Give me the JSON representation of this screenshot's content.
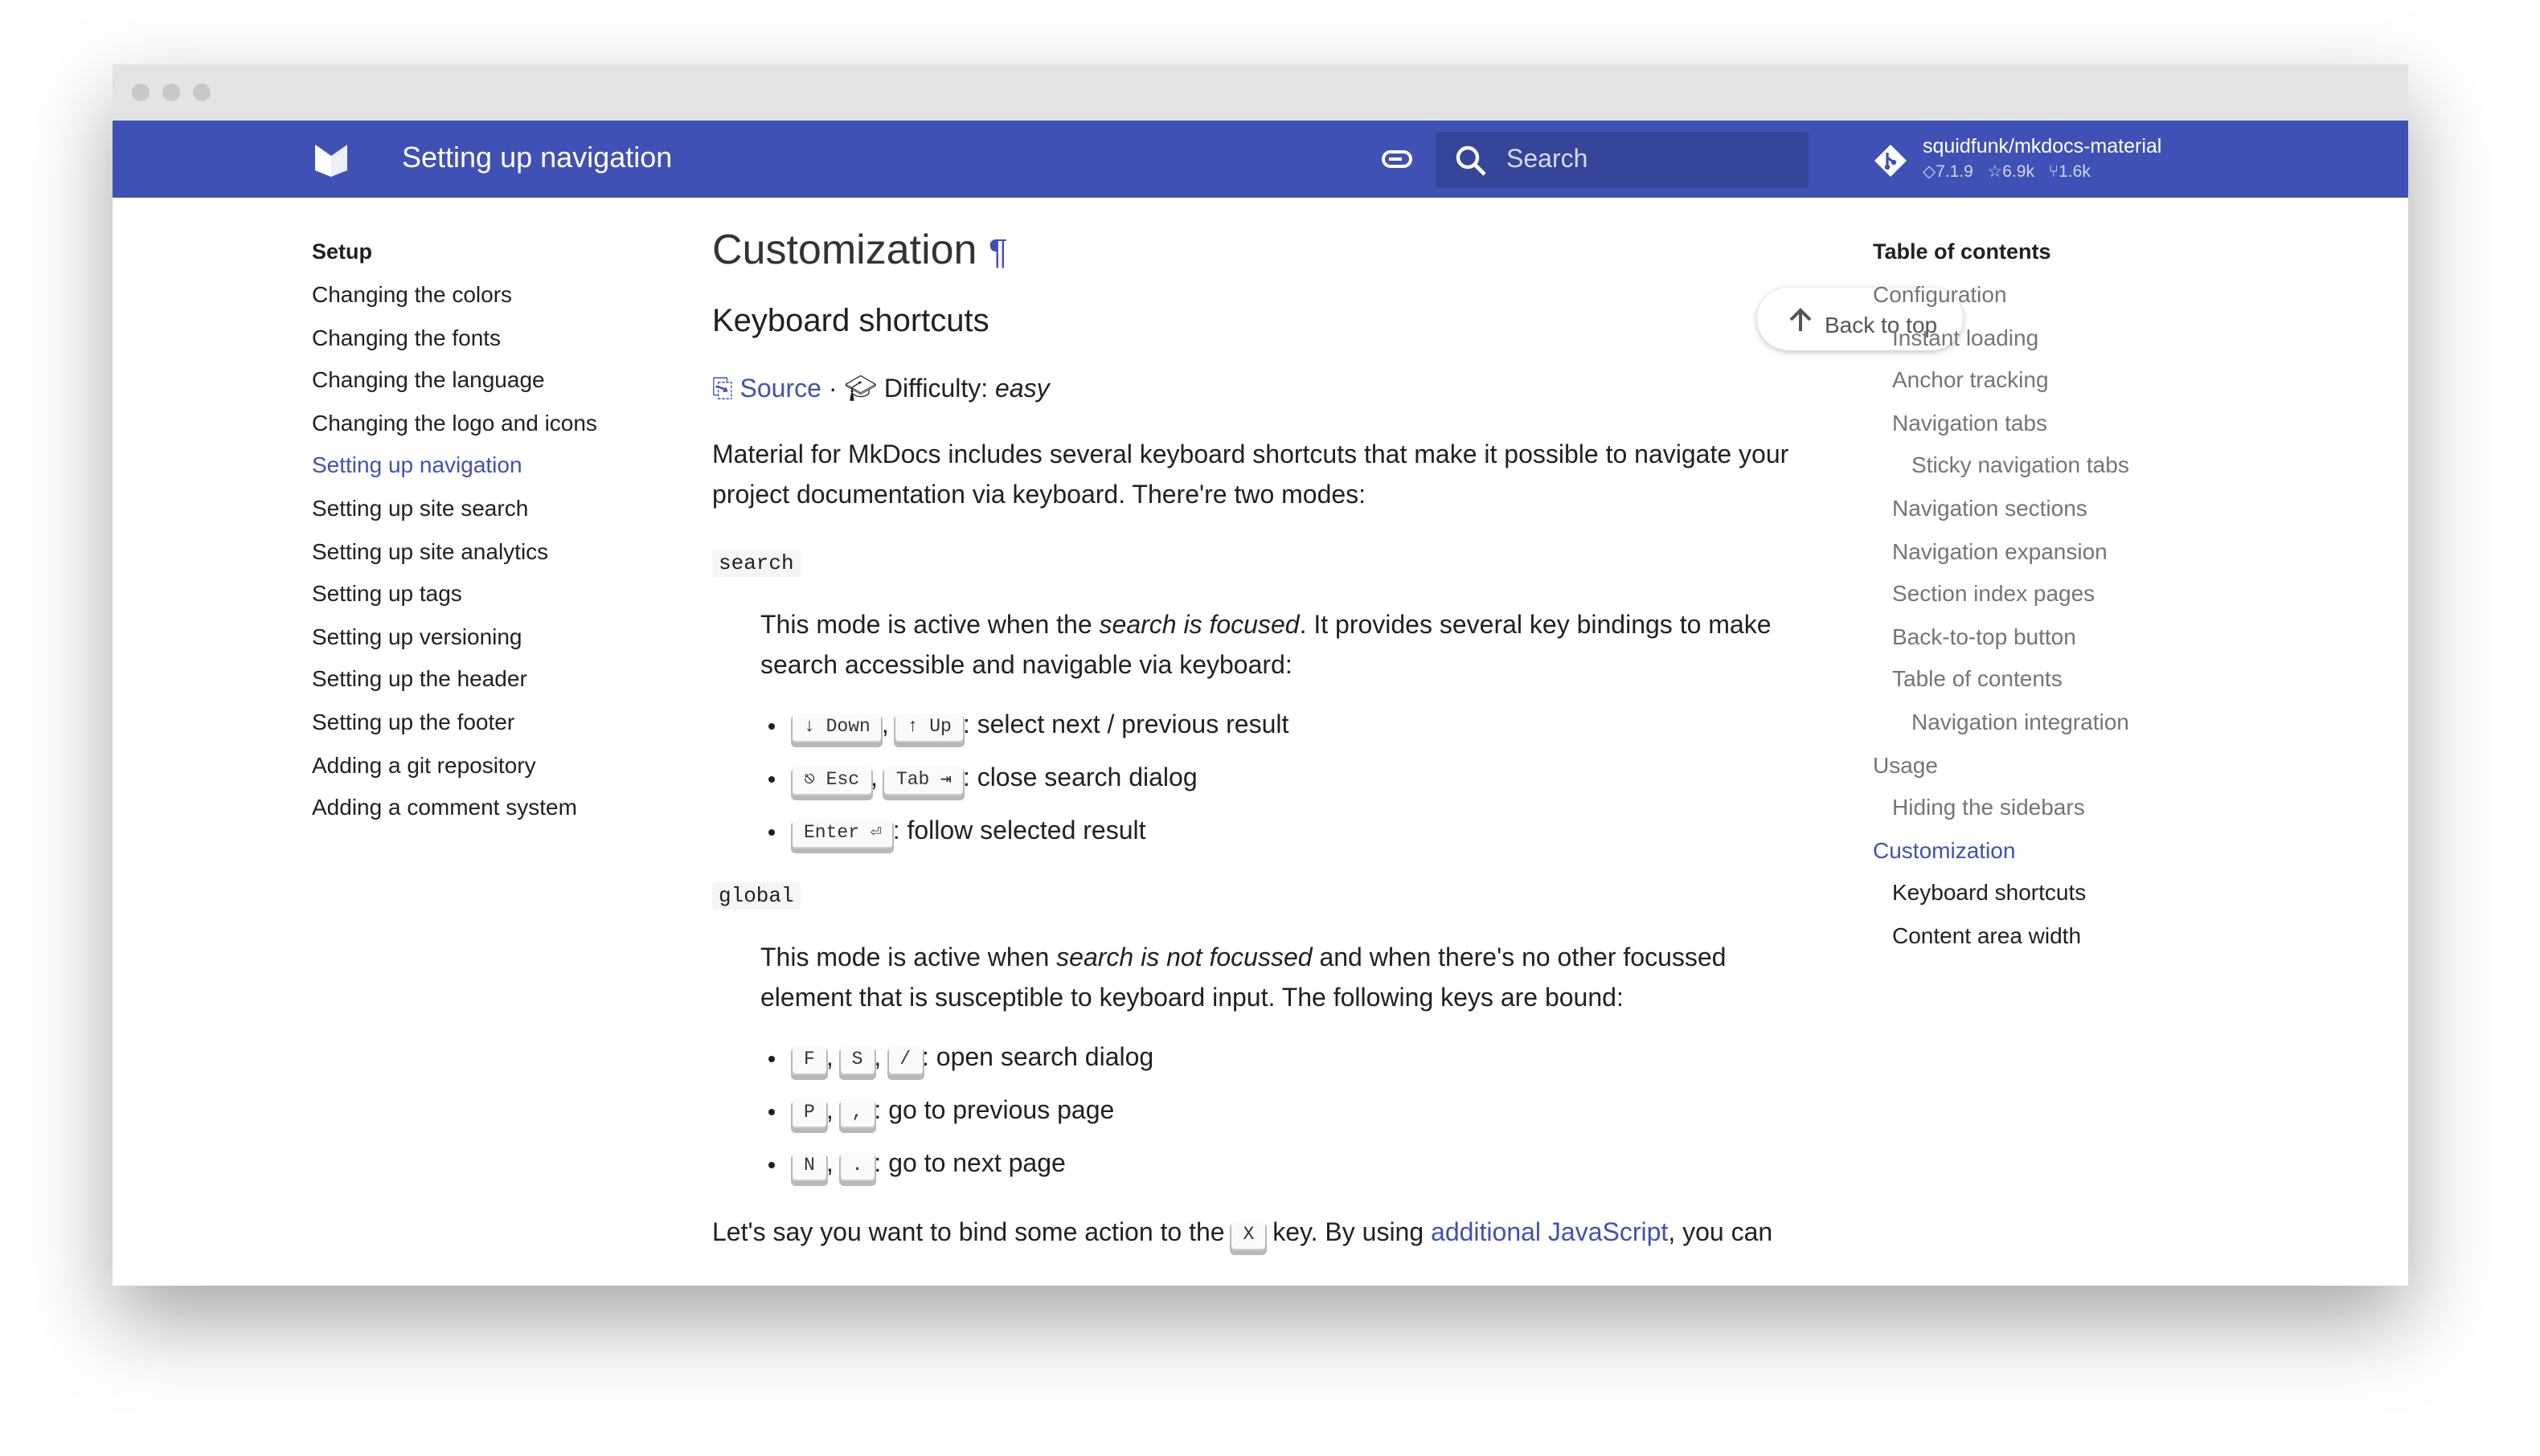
{
  "header": {
    "title": "Setting up navigation",
    "search_placeholder": "Search",
    "repo": {
      "name": "squidfunk/mkdocs-material",
      "version": "7.1.9",
      "stars": "6.9k",
      "forks": "1.6k"
    },
    "color": "#4051b5"
  },
  "nav": {
    "heading": "Setup",
    "items": [
      "Changing the colors",
      "Changing the fonts",
      "Changing the language",
      "Changing the logo and icons",
      "Setting up navigation",
      "Setting up site search",
      "Setting up site analytics",
      "Setting up tags",
      "Setting up versioning",
      "Setting up the header",
      "Setting up the footer",
      "Adding a git repository",
      "Adding a comment system"
    ],
    "active": "Setting up navigation"
  },
  "toc": {
    "heading": "Table of contents",
    "items": [
      {
        "label": "Configuration",
        "level": 1
      },
      {
        "label": "Instant loading",
        "level": 2
      },
      {
        "label": "Anchor tracking",
        "level": 2
      },
      {
        "label": "Navigation tabs",
        "level": 2
      },
      {
        "label": "Sticky navigation tabs",
        "level": 3
      },
      {
        "label": "Navigation sections",
        "level": 2
      },
      {
        "label": "Navigation expansion",
        "level": 2
      },
      {
        "label": "Section index pages",
        "level": 2
      },
      {
        "label": "Back-to-top button",
        "level": 2
      },
      {
        "label": "Table of contents",
        "level": 2
      },
      {
        "label": "Navigation integration",
        "level": 3
      },
      {
        "label": "Usage",
        "level": 1
      },
      {
        "label": "Hiding the sidebars",
        "level": 2
      },
      {
        "label": "Customization",
        "level": 1,
        "active": true
      },
      {
        "label": "Keyboard shortcuts",
        "level": 2,
        "current": true
      },
      {
        "label": "Content area width",
        "level": 2,
        "current": true
      }
    ]
  },
  "main": {
    "title": "Customization",
    "back_to_top": "Back to top",
    "subtitle": "Keyboard shortcuts",
    "source": "Source",
    "difficulty_label": "Difficulty:",
    "difficulty": "easy",
    "intro": "Material for MkDocs includes several keyboard shortcuts that make it possible to navigate your project documentation via keyboard. There're two modes:",
    "search": {
      "term": "search",
      "desc_a": "This mode is active when the ",
      "desc_em": "search is focused",
      "desc_b": ". It provides several key bindings to make search accessible and navigable via keyboard:",
      "items": [
        {
          "keys": [
            "↓ Down",
            "↑ Up"
          ],
          "text": ": select next / previous result"
        },
        {
          "keys": [
            "⎋ Esc",
            "Tab ⇥"
          ],
          "text": ": close search dialog"
        },
        {
          "keys": [
            "Enter ⏎"
          ],
          "text": ": follow selected result"
        }
      ]
    },
    "global": {
      "term": "global",
      "desc_a": "This mode is active when ",
      "desc_em": "search is not focussed",
      "desc_b": " and when there's no other focussed element that is susceptible to keyboard input. The following keys are bound:",
      "items": [
        {
          "keys": [
            "F",
            "S",
            "/"
          ],
          "text": ": open search dialog"
        },
        {
          "keys": [
            "P",
            ","
          ],
          "text": ": go to previous page"
        },
        {
          "keys": [
            "N",
            "."
          ],
          "text": ": go to next page"
        }
      ]
    },
    "outro_a": "Let's say you want to bind some action to the ",
    "outro_key": "X",
    "outro_b": " key. By using ",
    "outro_link": "additional JavaScript",
    "outro_c": ", you can"
  }
}
